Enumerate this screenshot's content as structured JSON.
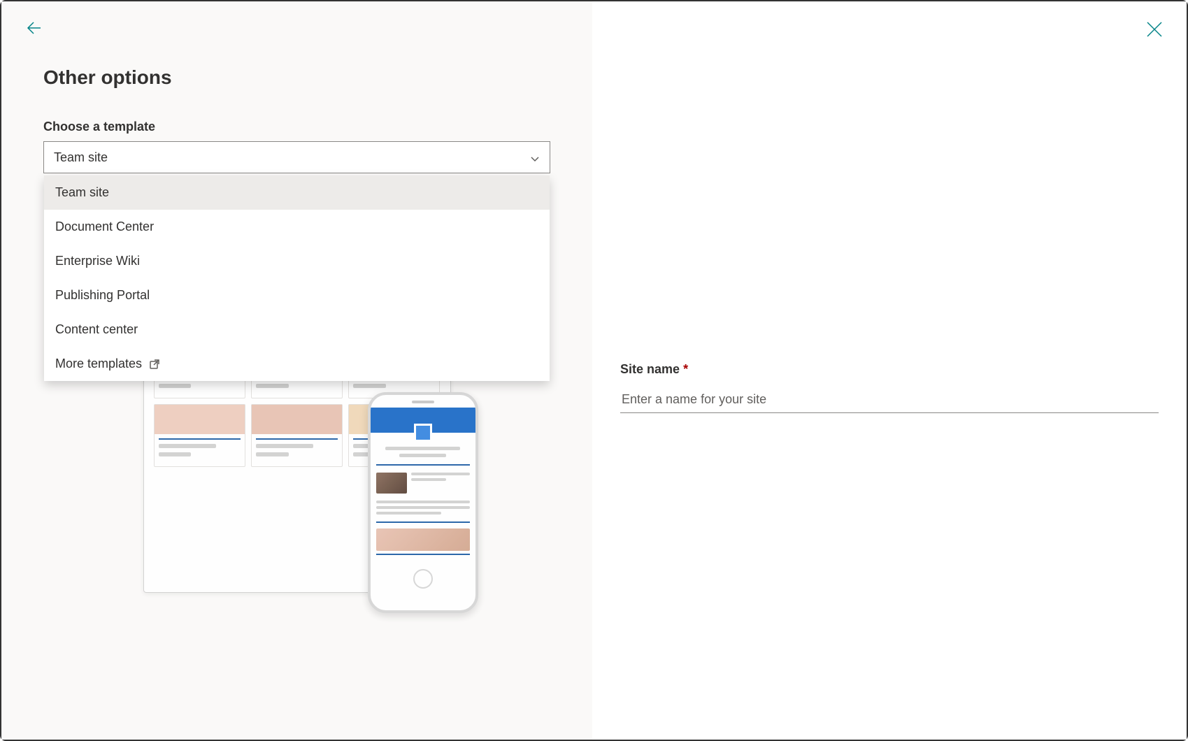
{
  "panel": {
    "title": "Other options"
  },
  "template": {
    "label": "Choose a template",
    "selected": "Team site",
    "options": [
      "Team site",
      "Document Center",
      "Enterprise Wiki",
      "Publishing Portal",
      "Content center"
    ],
    "more_label": "More templates"
  },
  "form": {
    "site_name_label": "Site name",
    "site_name_required": "*",
    "site_name_placeholder": "Enter a name for your site"
  }
}
